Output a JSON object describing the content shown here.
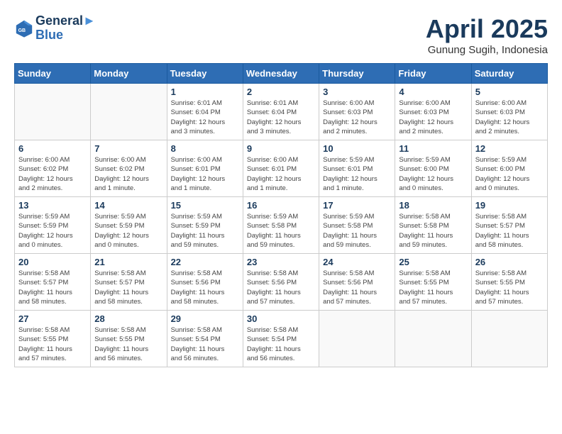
{
  "header": {
    "logo_line1": "General",
    "logo_line2": "Blue",
    "month_title": "April 2025",
    "subtitle": "Gunung Sugih, Indonesia"
  },
  "weekdays": [
    "Sunday",
    "Monday",
    "Tuesday",
    "Wednesday",
    "Thursday",
    "Friday",
    "Saturday"
  ],
  "weeks": [
    [
      {
        "day": "",
        "info": ""
      },
      {
        "day": "",
        "info": ""
      },
      {
        "day": "1",
        "info": "Sunrise: 6:01 AM\nSunset: 6:04 PM\nDaylight: 12 hours\nand 3 minutes."
      },
      {
        "day": "2",
        "info": "Sunrise: 6:01 AM\nSunset: 6:04 PM\nDaylight: 12 hours\nand 3 minutes."
      },
      {
        "day": "3",
        "info": "Sunrise: 6:00 AM\nSunset: 6:03 PM\nDaylight: 12 hours\nand 2 minutes."
      },
      {
        "day": "4",
        "info": "Sunrise: 6:00 AM\nSunset: 6:03 PM\nDaylight: 12 hours\nand 2 minutes."
      },
      {
        "day": "5",
        "info": "Sunrise: 6:00 AM\nSunset: 6:03 PM\nDaylight: 12 hours\nand 2 minutes."
      }
    ],
    [
      {
        "day": "6",
        "info": "Sunrise: 6:00 AM\nSunset: 6:02 PM\nDaylight: 12 hours\nand 2 minutes."
      },
      {
        "day": "7",
        "info": "Sunrise: 6:00 AM\nSunset: 6:02 PM\nDaylight: 12 hours\nand 1 minute."
      },
      {
        "day": "8",
        "info": "Sunrise: 6:00 AM\nSunset: 6:01 PM\nDaylight: 12 hours\nand 1 minute."
      },
      {
        "day": "9",
        "info": "Sunrise: 6:00 AM\nSunset: 6:01 PM\nDaylight: 12 hours\nand 1 minute."
      },
      {
        "day": "10",
        "info": "Sunrise: 5:59 AM\nSunset: 6:01 PM\nDaylight: 12 hours\nand 1 minute."
      },
      {
        "day": "11",
        "info": "Sunrise: 5:59 AM\nSunset: 6:00 PM\nDaylight: 12 hours\nand 0 minutes."
      },
      {
        "day": "12",
        "info": "Sunrise: 5:59 AM\nSunset: 6:00 PM\nDaylight: 12 hours\nand 0 minutes."
      }
    ],
    [
      {
        "day": "13",
        "info": "Sunrise: 5:59 AM\nSunset: 5:59 PM\nDaylight: 12 hours\nand 0 minutes."
      },
      {
        "day": "14",
        "info": "Sunrise: 5:59 AM\nSunset: 5:59 PM\nDaylight: 12 hours\nand 0 minutes."
      },
      {
        "day": "15",
        "info": "Sunrise: 5:59 AM\nSunset: 5:59 PM\nDaylight: 11 hours\nand 59 minutes."
      },
      {
        "day": "16",
        "info": "Sunrise: 5:59 AM\nSunset: 5:58 PM\nDaylight: 11 hours\nand 59 minutes."
      },
      {
        "day": "17",
        "info": "Sunrise: 5:59 AM\nSunset: 5:58 PM\nDaylight: 11 hours\nand 59 minutes."
      },
      {
        "day": "18",
        "info": "Sunrise: 5:58 AM\nSunset: 5:58 PM\nDaylight: 11 hours\nand 59 minutes."
      },
      {
        "day": "19",
        "info": "Sunrise: 5:58 AM\nSunset: 5:57 PM\nDaylight: 11 hours\nand 58 minutes."
      }
    ],
    [
      {
        "day": "20",
        "info": "Sunrise: 5:58 AM\nSunset: 5:57 PM\nDaylight: 11 hours\nand 58 minutes."
      },
      {
        "day": "21",
        "info": "Sunrise: 5:58 AM\nSunset: 5:57 PM\nDaylight: 11 hours\nand 58 minutes."
      },
      {
        "day": "22",
        "info": "Sunrise: 5:58 AM\nSunset: 5:56 PM\nDaylight: 11 hours\nand 58 minutes."
      },
      {
        "day": "23",
        "info": "Sunrise: 5:58 AM\nSunset: 5:56 PM\nDaylight: 11 hours\nand 57 minutes."
      },
      {
        "day": "24",
        "info": "Sunrise: 5:58 AM\nSunset: 5:56 PM\nDaylight: 11 hours\nand 57 minutes."
      },
      {
        "day": "25",
        "info": "Sunrise: 5:58 AM\nSunset: 5:55 PM\nDaylight: 11 hours\nand 57 minutes."
      },
      {
        "day": "26",
        "info": "Sunrise: 5:58 AM\nSunset: 5:55 PM\nDaylight: 11 hours\nand 57 minutes."
      }
    ],
    [
      {
        "day": "27",
        "info": "Sunrise: 5:58 AM\nSunset: 5:55 PM\nDaylight: 11 hours\nand 57 minutes."
      },
      {
        "day": "28",
        "info": "Sunrise: 5:58 AM\nSunset: 5:55 PM\nDaylight: 11 hours\nand 56 minutes."
      },
      {
        "day": "29",
        "info": "Sunrise: 5:58 AM\nSunset: 5:54 PM\nDaylight: 11 hours\nand 56 minutes."
      },
      {
        "day": "30",
        "info": "Sunrise: 5:58 AM\nSunset: 5:54 PM\nDaylight: 11 hours\nand 56 minutes."
      },
      {
        "day": "",
        "info": ""
      },
      {
        "day": "",
        "info": ""
      },
      {
        "day": "",
        "info": ""
      }
    ]
  ]
}
